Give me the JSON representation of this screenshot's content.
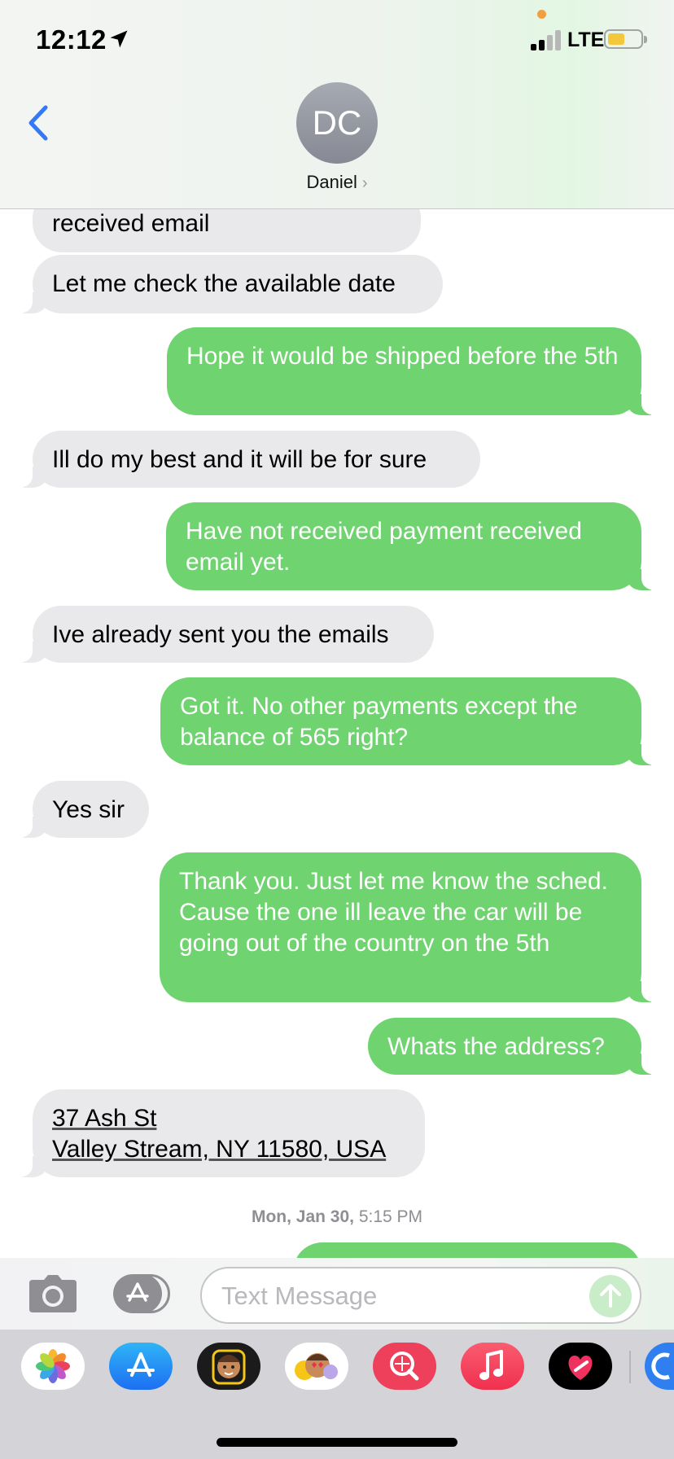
{
  "status_bar": {
    "time": "12:12",
    "network": "LTE"
  },
  "header": {
    "avatar_initials": "DC",
    "contact_name": "Daniel",
    "chevron": "›"
  },
  "messages": [
    {
      "direction": "in",
      "text": "received email"
    },
    {
      "direction": "in",
      "text": "Let me check the available date"
    },
    {
      "direction": "out",
      "text": "Hope it would be shipped before the 5th"
    },
    {
      "direction": "in",
      "text": "Ill do my best and it will be for sure"
    },
    {
      "direction": "out",
      "text": "Have not received payment received email yet."
    },
    {
      "direction": "in",
      "text": "Ive already sent you the emails"
    },
    {
      "direction": "out",
      "text": "Got it. No other payments except the balance of 565 right?"
    },
    {
      "direction": "in",
      "text": "Yes sir"
    },
    {
      "direction": "out",
      "text": "Thank you. Just let me know the sched. Cause the one ill leave the car will be going out of the country on the 5th"
    },
    {
      "direction": "out",
      "text": "Whats the address?"
    },
    {
      "direction": "in",
      "address_line1": "37 Ash St",
      "address_line2": "Valley Stream, NY 11580, USA"
    }
  ],
  "timestamp": {
    "day": "Mon, Jan 30,",
    "time": "5:15 PM"
  },
  "composer": {
    "placeholder": "Text Message"
  },
  "app_drawer": [
    "photos-icon",
    "app-store-icon",
    "memoji-icon",
    "animoji-stickers-icon",
    "image-search-icon",
    "music-icon",
    "heart-app-icon"
  ],
  "colors": {
    "outgoing": "#6fd36f",
    "incoming": "#e9e9eb",
    "accent": "#3478f6"
  }
}
